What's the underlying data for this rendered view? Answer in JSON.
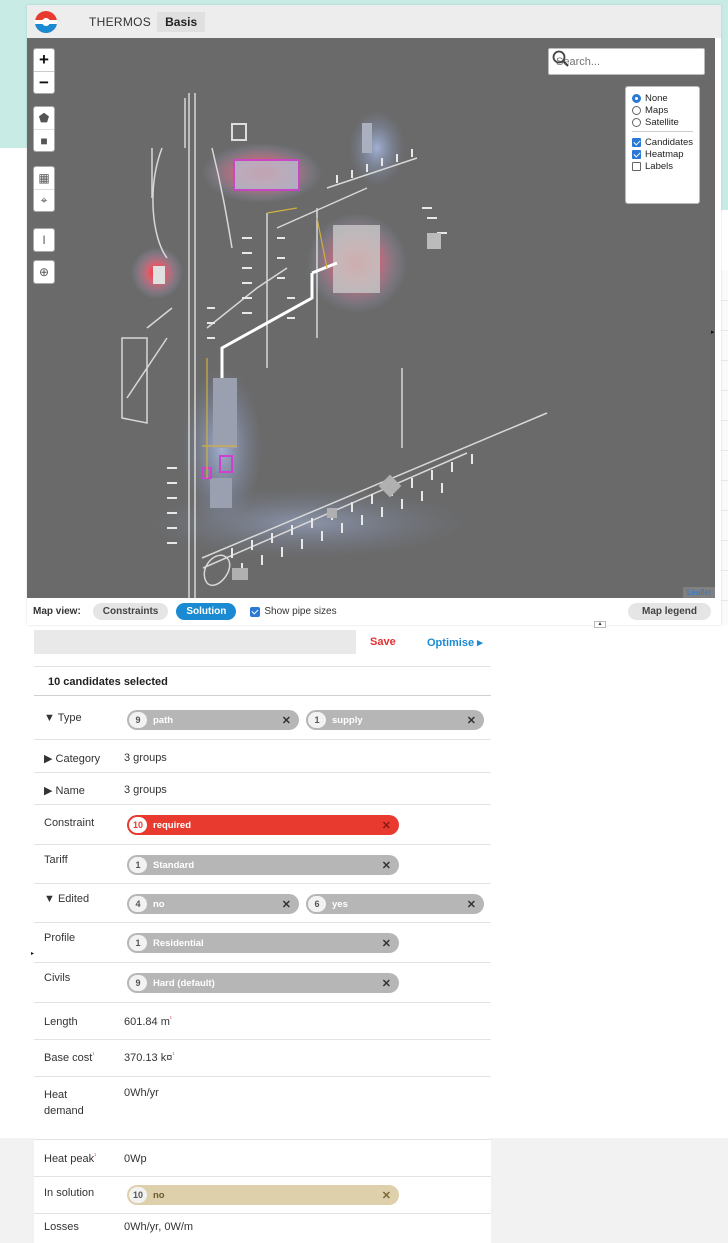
{
  "app": {
    "name": "THERMOS",
    "project": "Basis"
  },
  "map": {
    "zoom_in": "+",
    "zoom_out": "−",
    "search_placeholder": "Search...",
    "layers": {
      "basemap": [
        "None",
        "Maps",
        "Satellite"
      ],
      "basemap_selected": "None",
      "overlays": [
        {
          "label": "Candidates",
          "checked": true
        },
        {
          "label": "Heatmap",
          "checked": true
        },
        {
          "label": "Labels",
          "checked": false
        }
      ]
    },
    "attribution": "Leaflet"
  },
  "mapview": {
    "label": "Map view:",
    "constraints": "Constraints",
    "solution": "Solution",
    "show_pipe_sizes": "Show pipe sizes",
    "map_legend": "Map legend"
  },
  "panel": {
    "save": "Save",
    "optimise": "Optimise ▸",
    "selected": "10 candidates selected",
    "rows": {
      "type": {
        "label": "▼ Type",
        "chips": [
          {
            "count": "9",
            "text": "path"
          },
          {
            "count": "1",
            "text": "supply"
          }
        ]
      },
      "category": {
        "label": "▶ Category",
        "value": "3 groups"
      },
      "name": {
        "label": "▶ Name",
        "value": "3 groups"
      },
      "constraint": {
        "label": "Constraint",
        "chip": {
          "count": "10",
          "text": "required"
        }
      },
      "tariff": {
        "label": "Tariff",
        "chip": {
          "count": "1",
          "text": "Standard"
        }
      },
      "edited": {
        "label": "▼ Edited",
        "chips": [
          {
            "count": "4",
            "text": "no"
          },
          {
            "count": "6",
            "text": "yes"
          }
        ]
      },
      "profile": {
        "label": "Profile",
        "chip": {
          "count": "1",
          "text": "Residential"
        }
      },
      "civils": {
        "label": "Civils",
        "chip": {
          "count": "9",
          "text": "Hard (default)"
        }
      },
      "length": {
        "label": "Length",
        "value": "601.84 m"
      },
      "base_cost": {
        "label": "Base cost",
        "value": "370.13 k¤"
      },
      "heat_demand": {
        "label_line1": "Heat",
        "label_line2": "demand",
        "value": "0Wh/yr"
      },
      "heat_peak": {
        "label": "Heat peak",
        "value": "0Wp"
      },
      "in_solution": {
        "label": "In solution",
        "chip": {
          "count": "10",
          "text": "no"
        }
      },
      "losses": {
        "label": "Losses",
        "value": "0Wh/yr, 0W/m"
      }
    }
  }
}
